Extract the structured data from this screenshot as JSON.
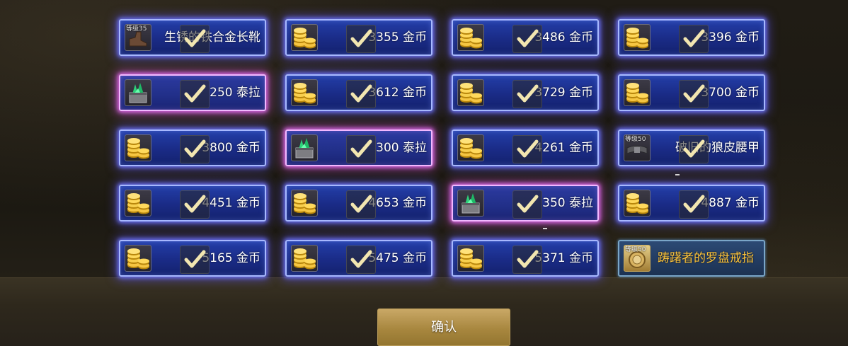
{
  "rewards": [
    {
      "label": "生锈的铁合金长靴",
      "icon": "boots-icon",
      "level": "等级35",
      "style": "blue"
    },
    {
      "label": "3355 金币",
      "icon": "gold-coins-icon",
      "style": "blue"
    },
    {
      "label": "3486 金币",
      "icon": "gold-coins-icon",
      "style": "blue"
    },
    {
      "label": "3396 金币",
      "icon": "gold-coins-icon",
      "style": "blue"
    },
    {
      "label": "250 泰拉",
      "icon": "tera-crystal-icon",
      "style": "purple"
    },
    {
      "label": "3612 金币",
      "icon": "gold-coins-icon",
      "style": "blue"
    },
    {
      "label": "3729 金币",
      "icon": "gold-coins-icon",
      "style": "blue"
    },
    {
      "label": "3700 金币",
      "icon": "gold-coins-icon",
      "style": "blue"
    },
    {
      "label": "3800 金币",
      "icon": "gold-coins-icon",
      "style": "blue"
    },
    {
      "label": "300 泰拉",
      "icon": "tera-crystal-icon",
      "style": "purple"
    },
    {
      "label": "4261 金币",
      "icon": "gold-coins-icon",
      "style": "blue"
    },
    {
      "label": "破旧的狼皮腰甲",
      "icon": "belt-icon",
      "level": "等级50",
      "style": "blue"
    },
    {
      "label": "4451 金币",
      "icon": "gold-coins-icon",
      "style": "blue"
    },
    {
      "label": "4653 金币",
      "icon": "gold-coins-icon",
      "style": "blue"
    },
    {
      "label": "350 泰拉",
      "icon": "tera-crystal-icon",
      "style": "purple"
    },
    {
      "label": "4887 金币",
      "icon": "gold-coins-icon",
      "style": "blue"
    },
    {
      "label": "5165 金币",
      "icon": "gold-coins-icon",
      "style": "blue"
    },
    {
      "label": "5475 金币",
      "icon": "gold-coins-icon",
      "style": "blue"
    },
    {
      "label": "5371 金币",
      "icon": "gold-coins-icon",
      "style": "blue"
    },
    {
      "label": "踌躇者的罗盘戒指",
      "icon": "compass-ring-icon",
      "level": "等级50",
      "style": "gold"
    }
  ],
  "confirm_label": "确认",
  "colors": {
    "card_blue": "#1f3599",
    "card_purple_glow": "#e070f0",
    "gold_text": "#ffc53a",
    "button_gold": "#b8974f"
  }
}
